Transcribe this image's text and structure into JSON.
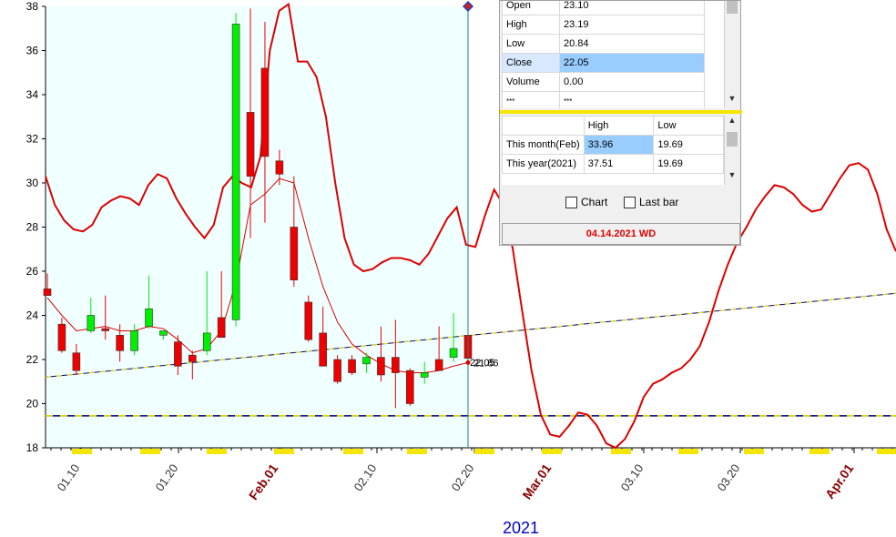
{
  "chart_data": {
    "type": "candlestick",
    "ylim": [
      18,
      38
    ],
    "y_ticks": [
      "18",
      "20",
      "22",
      "24",
      "26",
      "28",
      "30",
      "32",
      "34",
      "36",
      "38"
    ],
    "x_ticks": [
      "01.10",
      "01.20",
      "Feb.01",
      "02.10",
      "02.20",
      "Mar.01",
      "03.10",
      "03.20",
      "Apr.01"
    ],
    "x_ticks_highlight": [
      "Feb.01",
      "Mar.01",
      "Apr.01"
    ],
    "xlabel": "2021",
    "last_value_labels": [
      "22.05",
      "21.86"
    ],
    "colors": {
      "up": "#00ee00",
      "down": "#ee0000",
      "shade": "#f0ffff",
      "line": "#dd0000",
      "trend": "#000080",
      "dash": "#f5e600",
      "month": "#8b0000",
      "year": "#0000cc"
    },
    "candles": [
      {
        "o": 25.2,
        "h": 25.9,
        "l": 24.9,
        "c": 24.9
      },
      {
        "o": 23.6,
        "h": 23.9,
        "l": 22.3,
        "c": 22.4
      },
      {
        "o": 22.3,
        "h": 22.7,
        "l": 21.3,
        "c": 21.5
      },
      {
        "o": 23.3,
        "h": 24.8,
        "l": 23.2,
        "c": 24.0
      },
      {
        "o": 23.4,
        "h": 24.9,
        "l": 22.9,
        "c": 23.3
      },
      {
        "o": 23.1,
        "h": 23.6,
        "l": 21.9,
        "c": 22.4
      },
      {
        "o": 22.4,
        "h": 23.6,
        "l": 22.2,
        "c": 23.3
      },
      {
        "o": 23.5,
        "h": 25.8,
        "l": 23.4,
        "c": 24.3
      },
      {
        "o": 23.1,
        "h": 23.3,
        "l": 22.9,
        "c": 23.3
      },
      {
        "o": 22.8,
        "h": 23.1,
        "l": 21.3,
        "c": 21.7
      },
      {
        "o": 22.2,
        "h": 22.4,
        "l": 21.1,
        "c": 21.9
      },
      {
        "o": 22.4,
        "h": 26.0,
        "l": 22.2,
        "c": 23.2
      },
      {
        "o": 23.9,
        "h": 26.0,
        "l": 23.0,
        "c": 23.0
      },
      {
        "o": 23.8,
        "h": 37.7,
        "l": 23.5,
        "c": 37.2
      },
      {
        "o": 33.2,
        "h": 37.9,
        "l": 27.5,
        "c": 30.3
      },
      {
        "o": 35.2,
        "h": 37.3,
        "l": 28.2,
        "c": 31.2
      },
      {
        "o": 31.0,
        "h": 31.5,
        "l": 29.9,
        "c": 30.4
      },
      {
        "o": 28.0,
        "h": 30.3,
        "l": 25.3,
        "c": 25.6
      },
      {
        "o": 24.6,
        "h": 24.9,
        "l": 22.8,
        "c": 22.9
      },
      {
        "o": 23.2,
        "h": 24.4,
        "l": 21.7,
        "c": 21.7
      },
      {
        "o": 22.0,
        "h": 22.2,
        "l": 20.9,
        "c": 21.0
      },
      {
        "o": 22.0,
        "h": 22.2,
        "l": 21.3,
        "c": 21.4
      },
      {
        "o": 21.8,
        "h": 22.3,
        "l": 21.4,
        "c": 22.1
      },
      {
        "o": 22.1,
        "h": 23.5,
        "l": 21.0,
        "c": 21.3
      },
      {
        "o": 22.1,
        "h": 23.8,
        "l": 19.8,
        "c": 21.4
      },
      {
        "o": 21.5,
        "h": 21.6,
        "l": 19.9,
        "c": 20.0
      },
      {
        "o": 21.2,
        "h": 21.9,
        "l": 20.9,
        "c": 21.4
      },
      {
        "o": 22.0,
        "h": 23.5,
        "l": 21.5,
        "c": 21.5
      },
      {
        "o": 22.1,
        "h": 24.1,
        "l": 21.9,
        "c": 22.5
      },
      {
        "o": 23.1,
        "h": 23.2,
        "l": 20.8,
        "c": 22.05
      }
    ],
    "ma": [
      24.8,
      24.0,
      23.3,
      23.4,
      23.5,
      23.3,
      23.3,
      23.5,
      23.4,
      22.9,
      22.3,
      22.5,
      23.3,
      25.5,
      29.0,
      29.5,
      30.2,
      30.0,
      27.5,
      25.3,
      23.7,
      22.7,
      22.2,
      21.8,
      21.5,
      21.4,
      21.4,
      21.5,
      21.7,
      21.86
    ],
    "smooth": [
      30.3,
      29.0,
      28.3,
      27.9,
      27.8,
      28.1,
      28.9,
      29.2,
      29.4,
      29.3,
      29.0,
      29.9,
      30.4,
      30.2,
      29.3,
      28.6,
      28.0,
      27.5,
      28.1,
      29.8,
      30.3,
      30.0,
      29.8,
      31.2,
      36.0,
      37.8,
      38.1,
      35.5,
      35.5,
      34.8,
      33.0,
      30.0,
      27.5,
      26.3,
      26.0,
      26.1,
      26.4,
      26.6,
      26.6,
      26.5,
      26.3,
      26.8,
      27.6,
      28.4,
      28.9,
      27.2,
      27.1,
      28.5,
      29.7,
      29.0,
      27.0,
      24.2,
      21.5,
      19.5,
      18.6,
      18.5,
      19.0,
      19.6,
      19.5,
      19.0,
      18.2,
      18.0,
      18.4,
      19.2,
      20.3,
      20.9,
      21.1,
      21.4,
      21.6,
      22.0,
      22.6,
      23.7,
      25.1,
      26.3,
      27.3,
      28.0,
      28.8,
      29.4,
      29.9,
      29.8,
      29.5,
      29.0,
      28.7,
      28.8,
      29.5,
      30.2,
      30.8,
      30.9,
      30.6,
      29.5,
      27.9,
      26.9
    ],
    "trendline": {
      "y_start": 21.2,
      "y_end": 25.0
    },
    "hline": 19.45
  },
  "panel": {
    "quote_rows": [
      {
        "label": "Open",
        "value": "23.10"
      },
      {
        "label": "High",
        "value": "23.19"
      },
      {
        "label": "Low",
        "value": "20.84"
      },
      {
        "label": "Close",
        "value": "22.05"
      },
      {
        "label": "Volume",
        "value": "0.00"
      },
      {
        "label": "***",
        "value": "***"
      }
    ],
    "range_header": {
      "col1": "",
      "col2": "High",
      "col3": "Low"
    },
    "range_rows": [
      {
        "label": "This month(Feb)",
        "high": "33.96",
        "low": "19.69"
      },
      {
        "label": "This year(2021)",
        "high": "37.51",
        "low": "19.69"
      }
    ],
    "chart_checkbox": "Chart",
    "lastbar_checkbox": "Last bar",
    "date_label": "04.14.2021 WD"
  }
}
